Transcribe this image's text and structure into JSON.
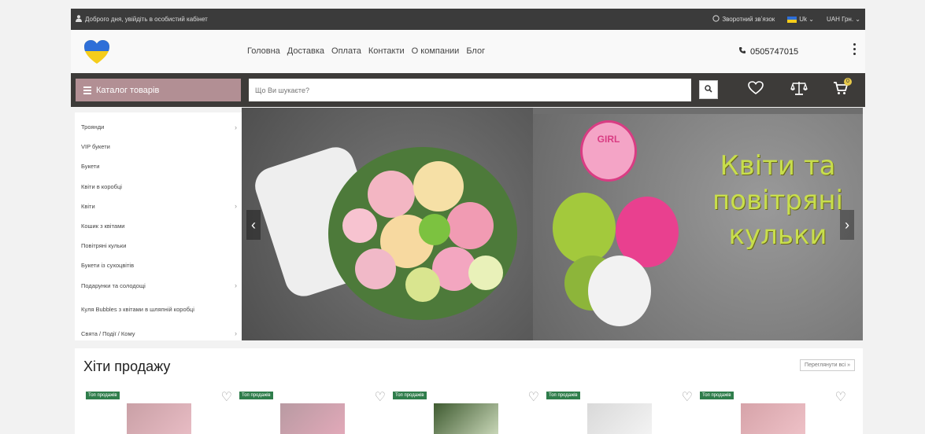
{
  "topbar": {
    "greeting": "Доброго дня, увійдіть в особистий кабінет",
    "callback": "Зворотний звʼязок",
    "language": "Uk ⌄",
    "currency": "UAH Грн. ⌄"
  },
  "header": {
    "nav": [
      "Головна",
      "Доставка",
      "Оплата",
      "Контакти",
      "О компании",
      "Блог"
    ],
    "phone": "0505747015"
  },
  "toolbar": {
    "catalog_label": "Каталог товарів",
    "search_placeholder": "Що Ви шукаєте?",
    "cart_count": "0"
  },
  "sidebar": {
    "items": [
      {
        "label": "Троянди",
        "has_children": true
      },
      {
        "label": "VIP букети",
        "has_children": false
      },
      {
        "label": "Букети",
        "has_children": false
      },
      {
        "label": "Квіти в коробці",
        "has_children": false
      },
      {
        "label": "Квіти",
        "has_children": true
      },
      {
        "label": "Кошик з квітами",
        "has_children": false
      },
      {
        "label": "Повітряні кульки",
        "has_children": false
      },
      {
        "label": "Букети із сухоцвітів",
        "has_children": false
      },
      {
        "label": "Подарунки та солодощі",
        "has_children": true
      },
      {
        "label": "Куля Bubbles з квітами в шляпній коробці",
        "has_children": false
      },
      {
        "label": "Свята / Події / Кому",
        "has_children": true
      }
    ]
  },
  "banner": {
    "line1": "Квіти та",
    "line2": "повітряні",
    "line3": "кульки",
    "balloon_text": "GIRL"
  },
  "bestsellers": {
    "title": "Хіти продажу",
    "view_all": "Переглянути всі »",
    "cards": [
      {
        "tag": "Топ продажів"
      },
      {
        "tag": "Топ продажів"
      },
      {
        "tag": "Топ продажів"
      },
      {
        "tag": "Топ продажів"
      },
      {
        "tag": "Топ продажів"
      }
    ]
  },
  "colors": {
    "topbar": "#3b3b3b",
    "darkbar": "#3d3b39",
    "catalog_button": "#b28f94",
    "tag_green": "#2f7d4b",
    "banner_text": "#c8de4c"
  }
}
